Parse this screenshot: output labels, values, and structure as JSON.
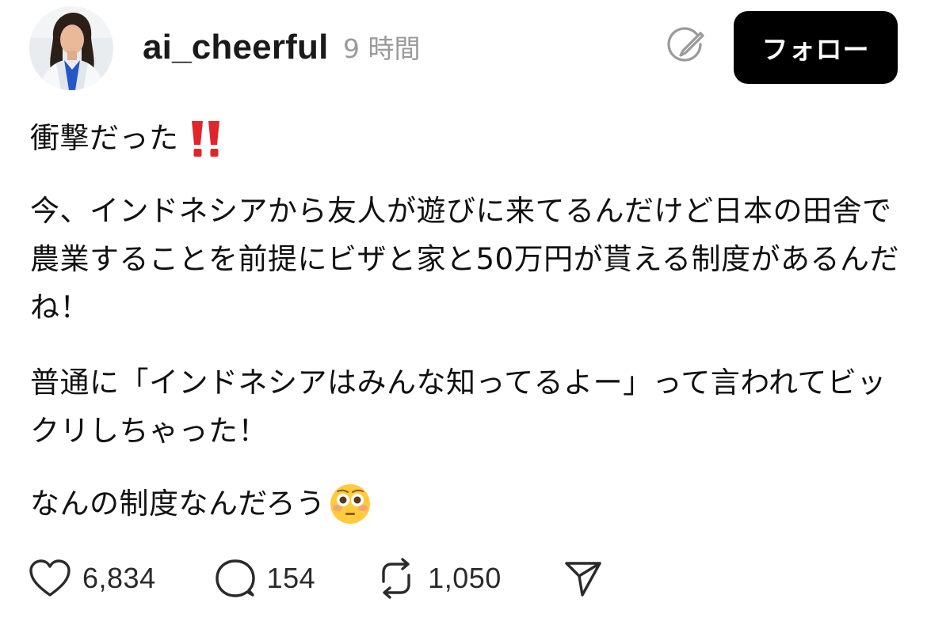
{
  "header": {
    "username": "ai_cheerful",
    "time": "9 時間",
    "follow_label": "フォロー"
  },
  "post": {
    "line1": "衝撃だった",
    "paragraph2": "今、インドネシアから友人が遊びに来てるんだけど日本の田舎で農業することを前提にビザと家と50万円が貰える制度があるんだね！",
    "paragraph3": "普通に「インドネシアはみんな知ってるよー」って言われてビックリしちゃった！",
    "line4": "なんの制度なんだろう"
  },
  "actions": {
    "likes": "6,834",
    "replies": "154",
    "reposts": "1,050"
  },
  "icons": {
    "exclamation": "double-exclamation-icon",
    "emoji": "flushed-face-icon",
    "like": "heart-icon",
    "reply": "speech-bubble-icon",
    "repost": "repost-icon",
    "share": "paper-plane-icon",
    "edit": "edit-circle-icon"
  },
  "colors": {
    "follow_button_bg": "#000000",
    "exclamation": "#e0262b",
    "muted_text": "#9a9a9a"
  }
}
